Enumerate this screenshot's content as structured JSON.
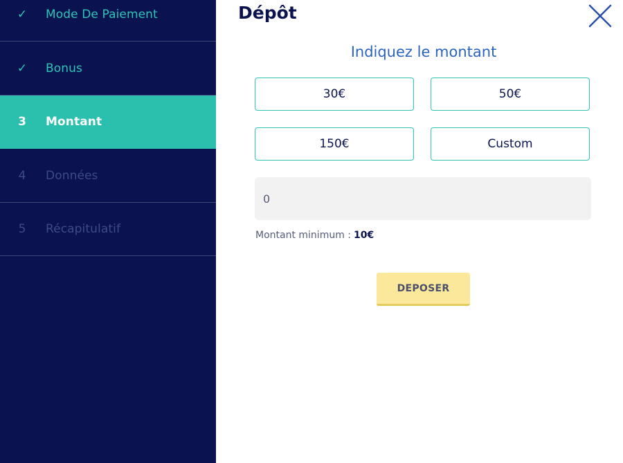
{
  "sidebar": {
    "steps": [
      {
        "marker": "✓",
        "label": "Mode De Paiement",
        "state": "done"
      },
      {
        "marker": "✓",
        "label": "Bonus",
        "state": "done"
      },
      {
        "marker": "3",
        "label": "Montant",
        "state": "active"
      },
      {
        "marker": "4",
        "label": "Données",
        "state": "pending"
      },
      {
        "marker": "5",
        "label": "Récapitulatif",
        "state": "pending"
      }
    ]
  },
  "main": {
    "title": "Dépôt",
    "close_icon": "close-icon",
    "subtitle": "Indiquez le montant",
    "amounts": [
      "30€",
      "50€",
      "150€",
      "Custom"
    ],
    "amount_input_value": "0",
    "min_label": "Montant minimum :",
    "min_value": "10€",
    "deposit_label": "DEPOSER"
  },
  "colors": {
    "sidebar_bg": "#0a1350",
    "active_step": "#2bbfae",
    "done_step_text": "#2ec4b6",
    "pending_step_text": "#3d4b86",
    "title": "#0a1350",
    "subtitle": "#2a63c0",
    "amount_border": "#2ec4b6",
    "deposit_bg": "#fbe89a"
  }
}
